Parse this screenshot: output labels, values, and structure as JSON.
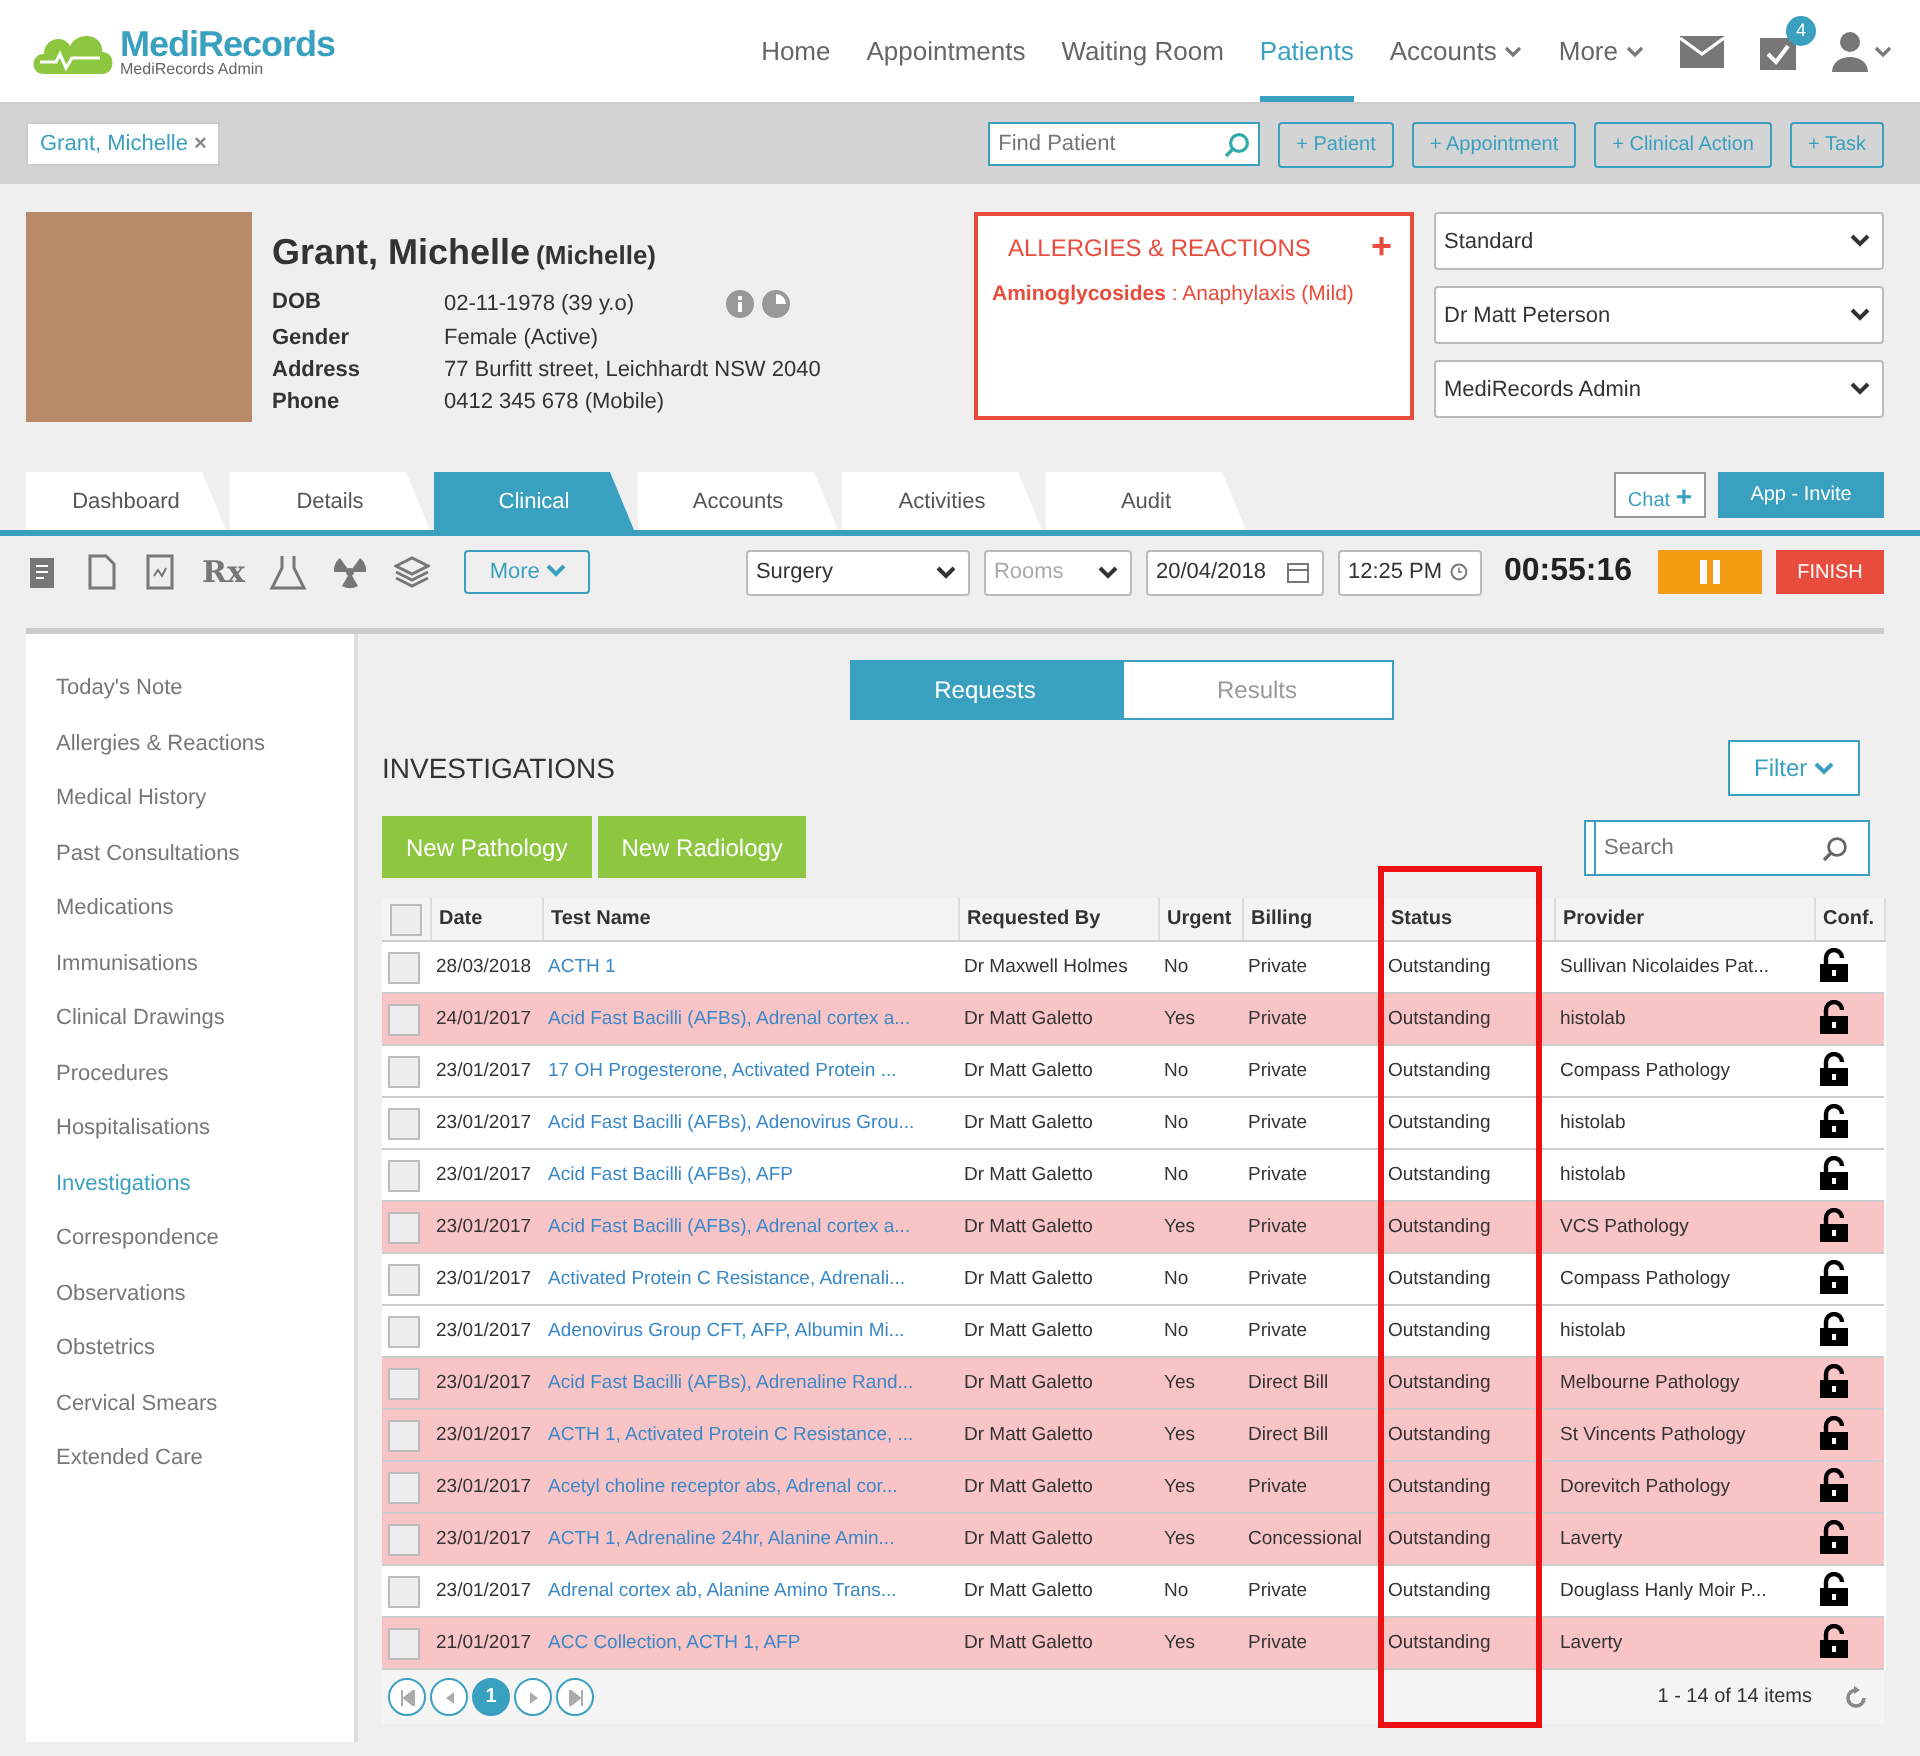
{
  "brand": {
    "name": "MediRecords",
    "subtitle": "MediRecords Admin"
  },
  "nav": [
    {
      "label": "Home",
      "selected": false,
      "caret": false
    },
    {
      "label": "Appointments",
      "selected": false,
      "caret": false
    },
    {
      "label": "Waiting Room",
      "selected": false,
      "caret": false
    },
    {
      "label": "Patients",
      "selected": true,
      "caret": false
    },
    {
      "label": "Accounts",
      "selected": false,
      "caret": true
    },
    {
      "label": "More",
      "selected": false,
      "caret": true
    }
  ],
  "tasks_badge": "4",
  "open_patient": {
    "label": "Grant, Michelle",
    "close": "×"
  },
  "find_patient": {
    "placeholder": "Find Patient"
  },
  "actions": [
    "+ Patient",
    "+ Appointment",
    "+ Clinical Action",
    "+ Task"
  ],
  "patient": {
    "name": "Grant, Michelle",
    "preferred": "(Michelle)",
    "fields": [
      {
        "label": "DOB",
        "value": "02-11-1978 (39 y.o)"
      },
      {
        "label": "Gender",
        "value": "Female (Active)"
      },
      {
        "label": "Address",
        "value": "77 Burfitt street, Leichhardt NSW 2040"
      },
      {
        "label": "Phone",
        "value": "0412 345 678 (Mobile)"
      }
    ]
  },
  "allergies": {
    "title": "ALLERGIES & REACTIONS",
    "add": "+",
    "items": [
      {
        "substance": "Aminoglycosides",
        "reaction": " : Anaphylaxis (Mild)"
      }
    ]
  },
  "selects": [
    "Standard",
    "Dr Matt Peterson",
    "MediRecords Admin"
  ],
  "tabs": [
    {
      "label": "Dashboard",
      "selected": false
    },
    {
      "label": "Details",
      "selected": false
    },
    {
      "label": "Clinical",
      "selected": true
    },
    {
      "label": "Accounts",
      "selected": false
    },
    {
      "label": "Activities",
      "selected": false
    },
    {
      "label": "Audit",
      "selected": false
    }
  ],
  "chat": {
    "label": "Chat",
    "plus": "+"
  },
  "invite": "App - Invite",
  "more": "More",
  "rx_icon": "Rx",
  "location": "Surgery",
  "rooms": {
    "placeholder": "Rooms"
  },
  "date": "20/04/2018",
  "time": "12:25 PM",
  "timer": "00:55:16",
  "finish": "FINISH",
  "sidebar": {
    "items": [
      {
        "label": "Today's Note",
        "selected": false
      },
      {
        "label": "Allergies & Reactions",
        "selected": false
      },
      {
        "label": "Medical History",
        "selected": false
      },
      {
        "label": "Past Consultations",
        "selected": false
      },
      {
        "label": "Medications",
        "selected": false
      },
      {
        "label": "Immunisations",
        "selected": false
      },
      {
        "label": "Clinical Drawings",
        "selected": false
      },
      {
        "label": "Procedures",
        "selected": false
      },
      {
        "label": "Hospitalisations",
        "selected": false
      },
      {
        "label": "Investigations",
        "selected": true
      },
      {
        "label": "Correspondence",
        "selected": false
      },
      {
        "label": "Observations",
        "selected": false
      },
      {
        "label": "Obstetrics",
        "selected": false
      },
      {
        "label": "Cervical Smears",
        "selected": false
      },
      {
        "label": "Extended Care",
        "selected": false
      }
    ]
  },
  "segment": [
    {
      "label": "Requests",
      "selected": true
    },
    {
      "label": "Results",
      "selected": false
    }
  ],
  "section_title": "INVESTIGATIONS",
  "filter": "Filter",
  "new_buttons": [
    "New Pathology",
    "New Radiology"
  ],
  "search": {
    "placeholder": "Search"
  },
  "table": {
    "select_all_checked": false,
    "columns": [
      "Date",
      "Test Name",
      "Requested By",
      "Urgent",
      "Billing",
      "Status",
      "Provider",
      "Conf."
    ],
    "rows": [
      {
        "checked": false,
        "highlighted": false,
        "cells": [
          "28/03/2018",
          "ACTH 1",
          "Dr Maxwell Holmes",
          "No",
          "Private",
          "Outstanding",
          "Sullivan Nicolaides Pat..."
        ]
      },
      {
        "checked": false,
        "highlighted": true,
        "cells": [
          "24/01/2017",
          "Acid Fast Bacilli (AFBs), Adrenal cortex a...",
          "Dr Matt Galetto",
          "Yes",
          "Private",
          "Outstanding",
          "histolab"
        ]
      },
      {
        "checked": false,
        "highlighted": false,
        "cells": [
          "23/01/2017",
          "17 OH Progesterone, Activated Protein ...",
          "Dr Matt Galetto",
          "No",
          "Private",
          "Outstanding",
          "Compass Pathology"
        ]
      },
      {
        "checked": false,
        "highlighted": false,
        "cells": [
          "23/01/2017",
          "Acid Fast Bacilli (AFBs), Adenovirus Grou...",
          "Dr Matt Galetto",
          "No",
          "Private",
          "Outstanding",
          "histolab"
        ]
      },
      {
        "checked": false,
        "highlighted": false,
        "cells": [
          "23/01/2017",
          "Acid Fast Bacilli (AFBs), AFP",
          "Dr Matt Galetto",
          "No",
          "Private",
          "Outstanding",
          "histolab"
        ]
      },
      {
        "checked": false,
        "highlighted": true,
        "cells": [
          "23/01/2017",
          "Acid Fast Bacilli (AFBs), Adrenal cortex a...",
          "Dr Matt Galetto",
          "Yes",
          "Private",
          "Outstanding",
          "VCS Pathology"
        ]
      },
      {
        "checked": false,
        "highlighted": false,
        "cells": [
          "23/01/2017",
          "Activated Protein C Resistance, Adrenali...",
          "Dr Matt Galetto",
          "No",
          "Private",
          "Outstanding",
          "Compass Pathology"
        ]
      },
      {
        "checked": false,
        "highlighted": false,
        "cells": [
          "23/01/2017",
          "Adenovirus Group CFT, AFP, Albumin Mi...",
          "Dr Matt Galetto",
          "No",
          "Private",
          "Outstanding",
          "histolab"
        ]
      },
      {
        "checked": false,
        "highlighted": true,
        "cells": [
          "23/01/2017",
          "Acid Fast Bacilli (AFBs), Adrenaline Rand...",
          "Dr Matt Galetto",
          "Yes",
          "Direct Bill",
          "Outstanding",
          "Melbourne Pathology"
        ]
      },
      {
        "checked": false,
        "highlighted": true,
        "cells": [
          "23/01/2017",
          "ACTH 1, Activated Protein C Resistance, ...",
          "Dr Matt Galetto",
          "Yes",
          "Direct Bill",
          "Outstanding",
          "St Vincents Pathology"
        ]
      },
      {
        "checked": false,
        "highlighted": true,
        "cells": [
          "23/01/2017",
          "Acetyl choline receptor abs, Adrenal cor...",
          "Dr Matt Galetto",
          "Yes",
          "Private",
          "Outstanding",
          "Dorevitch Pathology"
        ]
      },
      {
        "checked": false,
        "highlighted": true,
        "cells": [
          "23/01/2017",
          "ACTH 1, Adrenaline 24hr, Alanine Amin...",
          "Dr Matt Galetto",
          "Yes",
          "Concessional",
          "Outstanding",
          "Laverty"
        ]
      },
      {
        "checked": false,
        "highlighted": false,
        "cells": [
          "23/01/2017",
          "Adrenal cortex ab, Alanine Amino Trans...",
          "Dr Matt Galetto",
          "No",
          "Private",
          "Outstanding",
          "Douglass Hanly Moir P..."
        ]
      },
      {
        "checked": false,
        "highlighted": true,
        "cells": [
          "21/01/2017",
          "ACC Collection, ACTH 1, AFP",
          "Dr Matt Galetto",
          "Yes",
          "Private",
          "Outstanding",
          "Laverty"
        ]
      }
    ]
  },
  "pager": {
    "pages": [
      {
        "label": "1",
        "selected": true
      }
    ],
    "summary": "1 - 14 of 14 items"
  }
}
